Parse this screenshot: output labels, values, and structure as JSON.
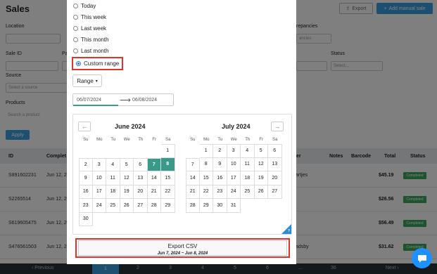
{
  "background": {
    "title": "Sales",
    "export_label": "Export",
    "add_sale_label": "Add manual sale",
    "location_label": "Location",
    "discrepancies_label": "repancies",
    "discrepancies_value": "ancies",
    "sale_id_label": "Sale ID",
    "pa_label": "Pa",
    "status_label": "Status",
    "status_placeholder": "Select...",
    "source_label": "Source",
    "source_placeholder": "Select a source",
    "products_label": "Products",
    "products_placeholder": "Search a product",
    "apply_label": "Apply",
    "columns": [
      "ID",
      "Complet",
      "er",
      "Notes",
      "Barcode",
      "Total",
      "Status"
    ],
    "rows": [
      {
        "id": "S891602231",
        "date": "Jun 12, 2",
        "customer": "artjes",
        "total": "$45.19",
        "status": "Completed"
      },
      {
        "id": "S2265514",
        "date": "Jun 12, 2",
        "customer": "",
        "total": "$26.56",
        "status": "Completed"
      },
      {
        "id": "S619605475",
        "date": "Jun 12, 2",
        "customer": "",
        "total": "$56.49",
        "status": "Completed"
      },
      {
        "id": "S476561503",
        "date": "Jun 12, 2",
        "customer": "adsby",
        "total": "$31.62",
        "status": "Completed"
      }
    ],
    "pager": {
      "prev": "Previous",
      "pages": [
        "1",
        "2",
        "3",
        "4",
        "5",
        "6",
        "...",
        "36"
      ],
      "next": "Next"
    }
  },
  "dropdown": {
    "options": [
      "Today",
      "This week",
      "Last week",
      "This month",
      "Last month",
      "Custom range"
    ],
    "selected": "Custom range",
    "range_button": "Range",
    "start_date": "06/07/2024",
    "end_date": "06/08/2024"
  },
  "calendar": {
    "weekdays": [
      "Su",
      "Mo",
      "Tu",
      "We",
      "Th",
      "Fr",
      "Sa"
    ],
    "months": [
      {
        "title": "June 2024",
        "first_weekday": 6,
        "days": 30
      },
      {
        "title": "July 2024",
        "first_weekday": 1,
        "days": 31
      }
    ],
    "selected_days": [
      7,
      8
    ],
    "help_glyph": "?"
  },
  "export": {
    "label": "Export CSV",
    "range_text": "Jun 7, 2024 ~ Jun 8, 2024"
  },
  "colors": {
    "accent": "#3aa0e0",
    "selected_day": "#3a9a8a",
    "highlight_border": "#e0342b",
    "completed": "#3aa85a"
  }
}
